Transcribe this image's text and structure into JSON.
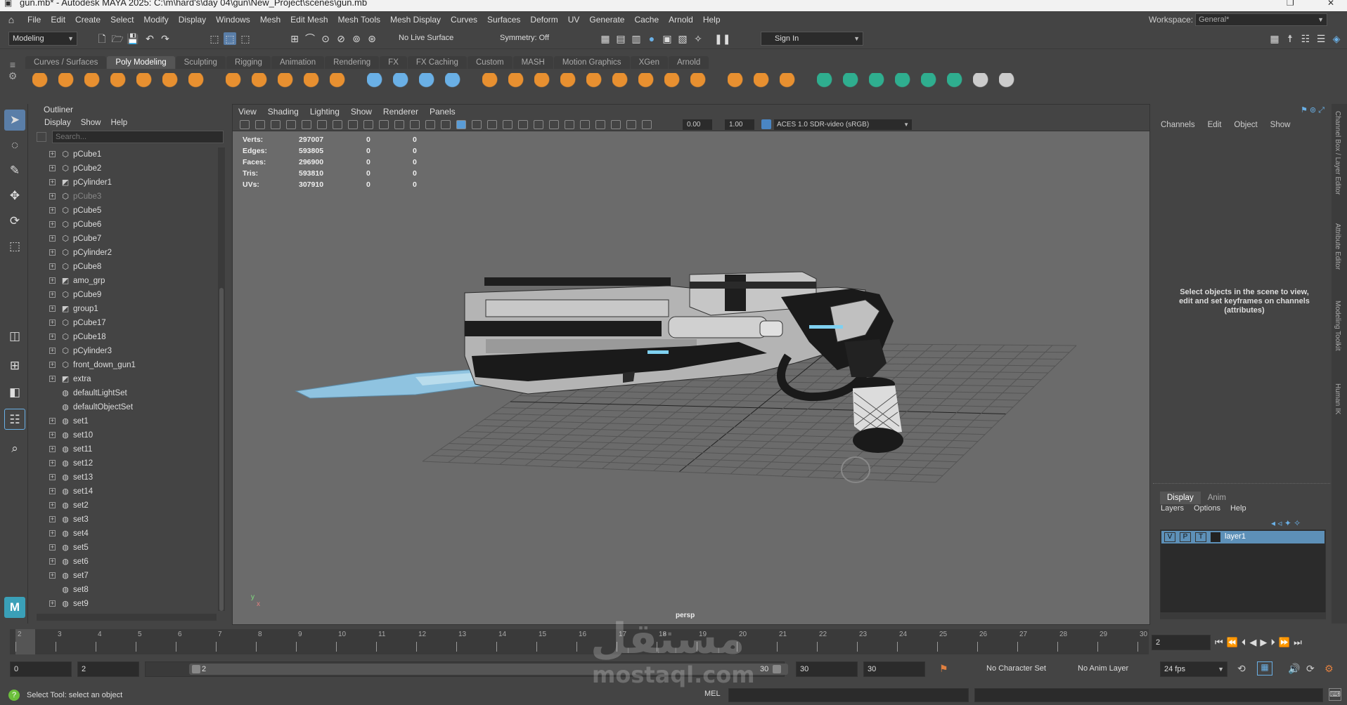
{
  "window": {
    "title": "gun.mb* - Autodesk MAYA 2025: C:\\m\\hard's\\day 04\\gun\\New_Project\\scenes\\gun.mb"
  },
  "menubar": [
    "File",
    "Edit",
    "Create",
    "Select",
    "Modify",
    "Display",
    "Windows",
    "Mesh",
    "Edit Mesh",
    "Mesh Tools",
    "Mesh Display",
    "Curves",
    "Surfaces",
    "Deform",
    "UV",
    "Generate",
    "Cache",
    "Arnold",
    "Help"
  ],
  "workspace": {
    "label": "Workspace:",
    "value": "General*"
  },
  "statusline": {
    "mode": "Modeling",
    "live_surface": "No Live Surface",
    "symmetry": "Symmetry: Off",
    "sign_in": "Sign In"
  },
  "shelf_tabs": [
    "Curves / Surfaces",
    "Poly Modeling",
    "Sculpting",
    "Rigging",
    "Animation",
    "Rendering",
    "FX",
    "FX Caching",
    "Custom",
    "MASH",
    "Motion Graphics",
    "XGen",
    "Arnold"
  ],
  "shelf_active": "Poly Modeling",
  "outliner": {
    "title": "Outliner",
    "menu": [
      "Display",
      "Show",
      "Help"
    ],
    "search_placeholder": "Search...",
    "items": [
      {
        "name": "pCube1",
        "type": "mesh"
      },
      {
        "name": "pCube2",
        "type": "mesh"
      },
      {
        "name": "pCylinder1",
        "type": "group"
      },
      {
        "name": "pCube3",
        "type": "mesh",
        "dim": true
      },
      {
        "name": "pCube5",
        "type": "mesh"
      },
      {
        "name": "pCube6",
        "type": "mesh"
      },
      {
        "name": "pCube7",
        "type": "mesh"
      },
      {
        "name": "pCylinder2",
        "type": "mesh"
      },
      {
        "name": "pCube8",
        "type": "mesh"
      },
      {
        "name": "amo_grp",
        "type": "group"
      },
      {
        "name": "pCube9",
        "type": "mesh"
      },
      {
        "name": "group1",
        "type": "group"
      },
      {
        "name": "pCube17",
        "type": "mesh"
      },
      {
        "name": "pCube18",
        "type": "mesh"
      },
      {
        "name": "pCylinder3",
        "type": "mesh"
      },
      {
        "name": "front_down_gun1",
        "type": "mesh"
      },
      {
        "name": "extra",
        "type": "group"
      },
      {
        "name": "defaultLightSet",
        "type": "set",
        "noexpand": true
      },
      {
        "name": "defaultObjectSet",
        "type": "set",
        "noexpand": true
      },
      {
        "name": "set1",
        "type": "set"
      },
      {
        "name": "set10",
        "type": "set"
      },
      {
        "name": "set11",
        "type": "set"
      },
      {
        "name": "set12",
        "type": "set"
      },
      {
        "name": "set13",
        "type": "set"
      },
      {
        "name": "set14",
        "type": "set"
      },
      {
        "name": "set2",
        "type": "set"
      },
      {
        "name": "set3",
        "type": "set"
      },
      {
        "name": "set4",
        "type": "set"
      },
      {
        "name": "set5",
        "type": "set"
      },
      {
        "name": "set6",
        "type": "set"
      },
      {
        "name": "set7",
        "type": "set"
      },
      {
        "name": "set8",
        "type": "set",
        "noexpand": true
      },
      {
        "name": "set9",
        "type": "set"
      }
    ]
  },
  "viewport": {
    "menu": [
      "View",
      "Shading",
      "Lighting",
      "Show",
      "Renderer",
      "Panels"
    ],
    "exposure": "0.00",
    "gamma": "1.00",
    "color_space": "ACES 1.0 SDR-video (sRGB)",
    "camera": "persp",
    "hud": [
      {
        "label": "Verts:",
        "v": "297007",
        "a": "0",
        "b": "0"
      },
      {
        "label": "Edges:",
        "v": "593805",
        "a": "0",
        "b": "0"
      },
      {
        "label": "Faces:",
        "v": "296900",
        "a": "0",
        "b": "0"
      },
      {
        "label": "Tris:",
        "v": "593810",
        "a": "0",
        "b": "0"
      },
      {
        "label": "UVs:",
        "v": "307910",
        "a": "0",
        "b": "0"
      }
    ]
  },
  "channelbox": {
    "menu": [
      "Channels",
      "Edit",
      "Object",
      "Show"
    ],
    "message": "Select objects in the scene to view, edit and set keyframes on channels (attributes)",
    "side_tabs": [
      "Channel Box / Layer Editor",
      "Attribute Editor",
      "Modeling Toolkit",
      "Human IK"
    ]
  },
  "layers": {
    "tabs": [
      "Display",
      "Anim"
    ],
    "menu": [
      "Layers",
      "Options",
      "Help"
    ],
    "layer": {
      "v": "V",
      "p": "P",
      "t": "T",
      "name": "layer1"
    }
  },
  "timeline": {
    "ticks": [
      "2",
      "3",
      "4",
      "5",
      "6",
      "7",
      "8",
      "9",
      "10",
      "11",
      "12",
      "13",
      "14",
      "15",
      "16",
      "17",
      "18",
      "19",
      "20",
      "21",
      "22",
      "23",
      "24",
      "25",
      "26",
      "27",
      "28",
      "29",
      "30"
    ],
    "current_frame": "2"
  },
  "range": {
    "start": "0",
    "playback_start": "2",
    "slider_start": "2",
    "slider_end": "30",
    "playback_end": "30",
    "end": "30",
    "character_set": "No Character Set",
    "anim_layer": "No Anim Layer",
    "fps": "24 fps"
  },
  "helpline": {
    "text": "Select Tool: select an object",
    "mel": "MEL"
  },
  "watermark": {
    "arabic": "مستقل",
    "latin": "mostaql.com"
  }
}
